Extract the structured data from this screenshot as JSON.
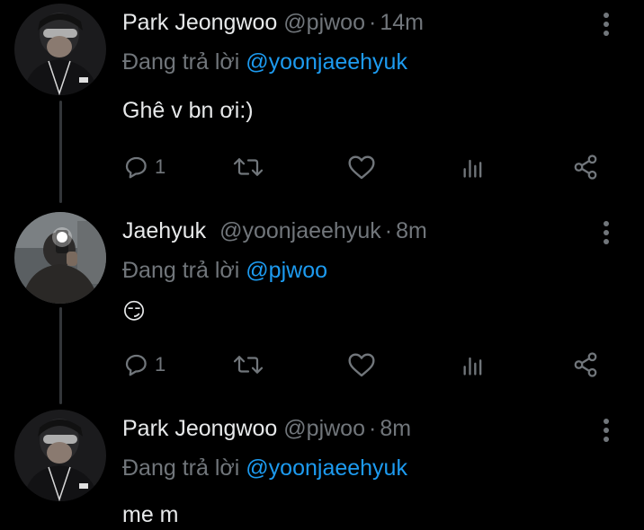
{
  "tweets": [
    {
      "name": "Park Jeongwoo",
      "handle": "@pjwoo",
      "time": "14m",
      "replying_prefix": "Đang trả lời",
      "replying_to": "@yoonjaeehyuk",
      "text": "Ghê v bn ơi:)",
      "reply_count": "1"
    },
    {
      "name": "Jaehyuk",
      "handle": "@yoonjaeehyuk",
      "time": "8m",
      "replying_prefix": "Đang trả lời",
      "replying_to": "@pjwoo",
      "text": "😏",
      "reply_count": "1"
    },
    {
      "name": "Park Jeongwoo",
      "handle": "@pjwoo",
      "time": "8m",
      "replying_prefix": "Đang trả lời",
      "replying_to": "@yoonjaeehyuk",
      "text": "me m"
    }
  ],
  "separator": "·",
  "icons": {
    "reply": "reply-icon",
    "retweet": "retweet-icon",
    "like": "heart-icon",
    "analytics": "analytics-icon",
    "share": "share-icon",
    "more": "more-vertical-icon"
  },
  "colors": {
    "background": "#000000",
    "text": "#e7e9ea",
    "secondary": "#71767b",
    "link": "#1d9bf0",
    "thread_line": "#333639"
  }
}
